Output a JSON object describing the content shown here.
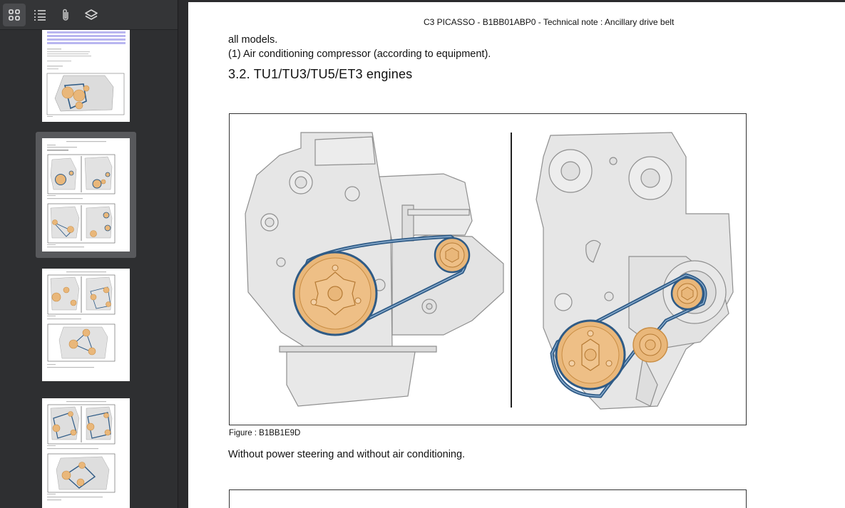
{
  "toolbar": {
    "icons": [
      "thumbnails-grid-icon",
      "outline-list-icon",
      "attachments-paperclip-icon",
      "layers-icon"
    ],
    "active": "thumbnails-grid-icon"
  },
  "sidebar": {
    "selected_index": 1,
    "thumbnail_count": 4
  },
  "document": {
    "header": "C3 PICASSO - B1BB01ABP0 - Technical note : Ancillary drive belt",
    "line1": "all models.",
    "line2": "(1) Air conditioning compressor  (according to equipment).",
    "section_title": "3.2. TU1/TU3/TU5/ET3 engines",
    "figure_caption": "Figure : B1BB1E9D",
    "paragraph": "Without power steering and without air conditioning."
  },
  "colors": {
    "pulley": "#e9b77a",
    "pulley_dark": "#c98d43",
    "belt": "#2f5b86",
    "engine": "#e4e4e4",
    "engine_line": "#8f8f8f",
    "selected_thumb": "#58595c"
  }
}
